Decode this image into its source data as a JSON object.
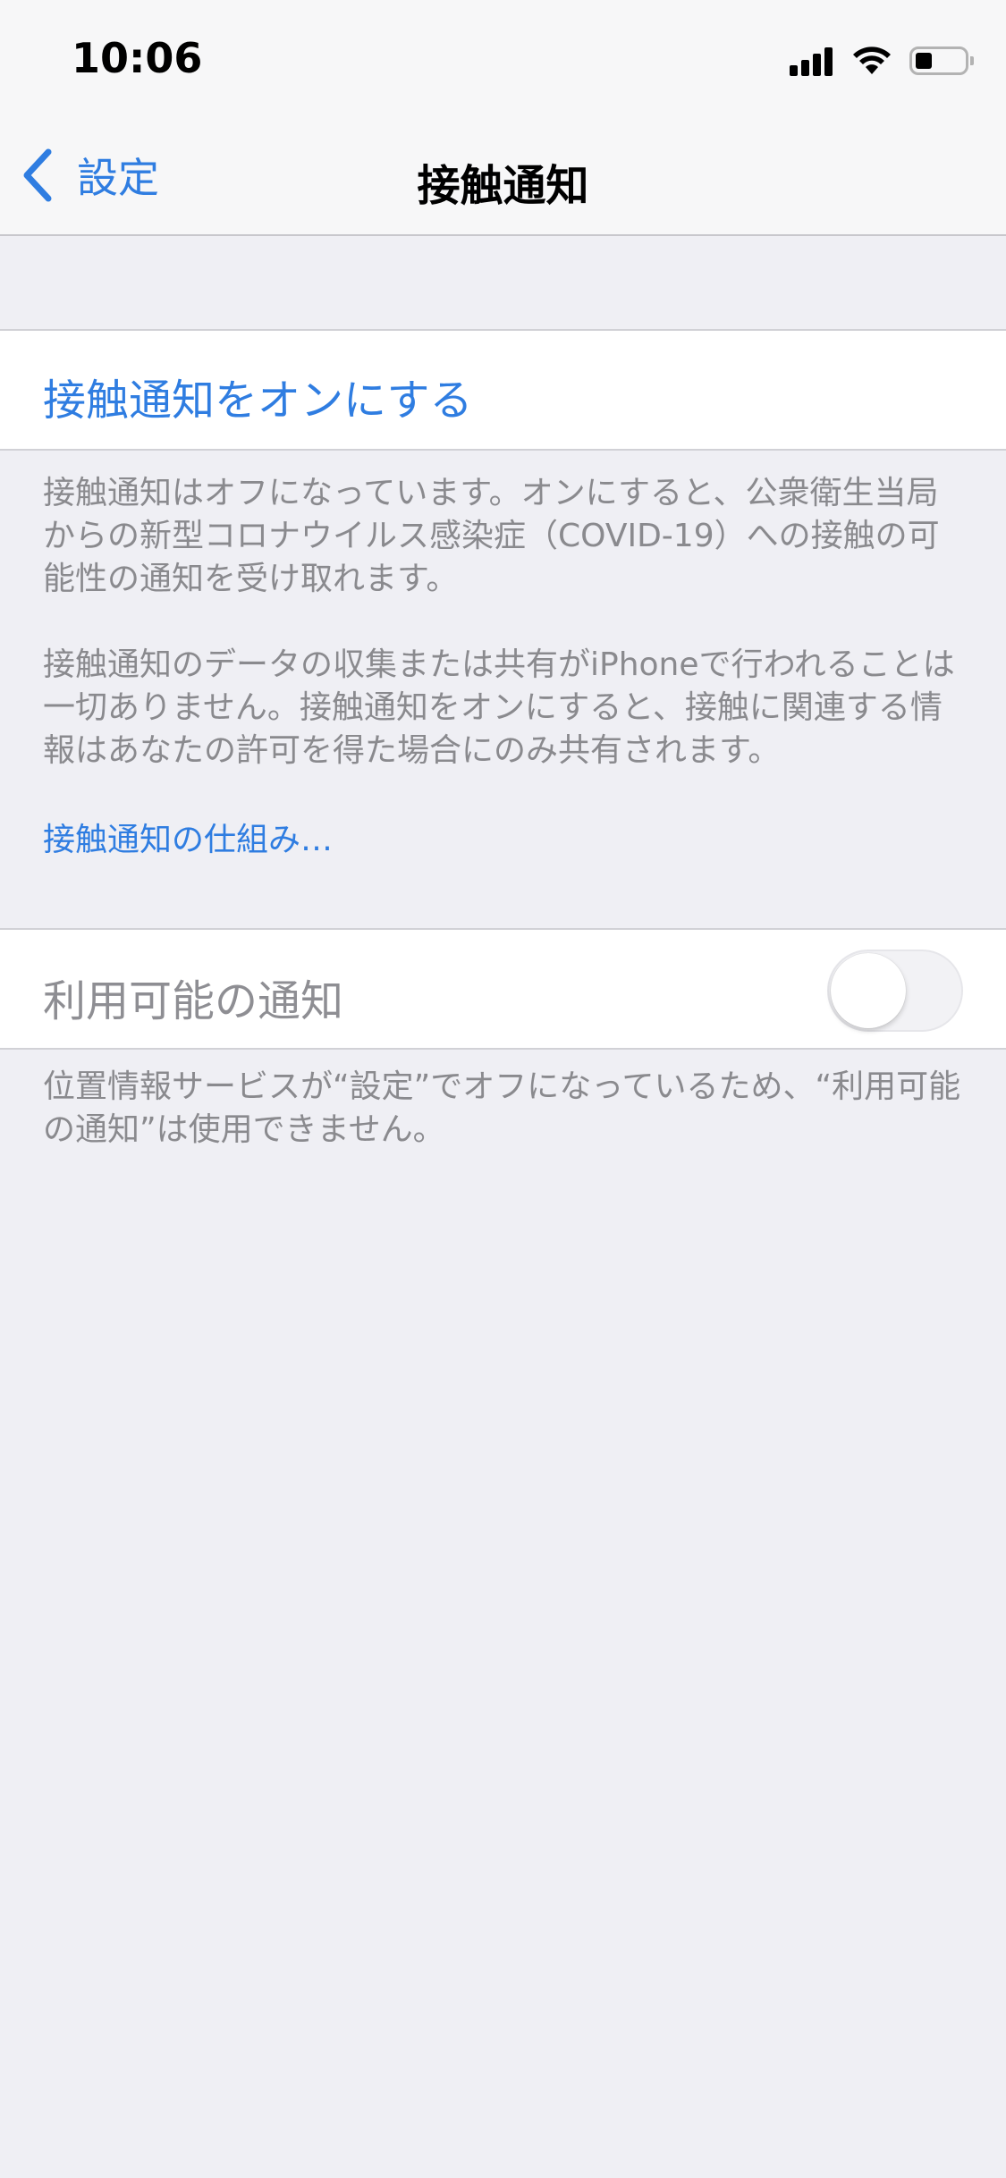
{
  "status_bar": {
    "time": "10:06",
    "icons": [
      "signal-icon",
      "wifi-icon",
      "battery-icon"
    ]
  },
  "nav": {
    "back_label": "設定",
    "title": "接触通知"
  },
  "main": {
    "turn_on_label": "接触通知をオンにする",
    "footer_paragraph_1": "接触通知はオフになっています。オンにすると、公衆衛生当局からの新型コロナウイルス感染症（COVID-19）への接触の可能性の通知を受け取れます。",
    "footer_paragraph_2": "接触通知のデータの収集または共有がiPhoneで行われることは一切ありません。接触通知をオンにすると、接触に関連する情報はあなたの許可を得た場合にのみ共有されます。",
    "learn_more_link": "接触通知の仕組み…",
    "availability_label": "利用可能の通知",
    "availability_toggle_on": false,
    "availability_footer": "位置情報サービスが“設定”でオフになっているため、“利用可能の通知”は使用できません。"
  },
  "colors": {
    "accent": "#2f7de1",
    "background": "#efeff4",
    "secondary_text": "#8a8a8e"
  }
}
